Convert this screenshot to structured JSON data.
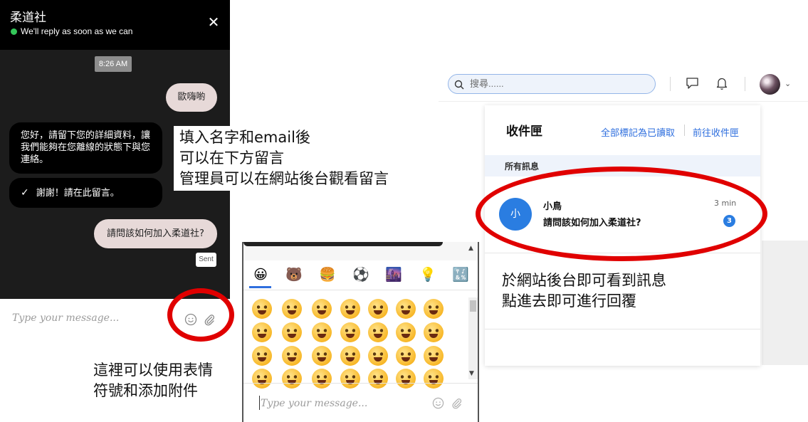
{
  "chat": {
    "title": "柔道社",
    "status": "We'll reply as soon as we can",
    "close_icon": "close-icon",
    "timestamp": "8:26 AM",
    "messages": {
      "hello": "歐嗨喲",
      "prompt": "您好，請留下您的詳細資料，讓我們能夠在您離線的狀態下與您連絡。",
      "thanks": "謝謝！請在此留言。",
      "question": "請問該如何加入柔道社?",
      "sent": "Sent"
    },
    "input_placeholder": "Type your message..."
  },
  "notes": {
    "fill_info": "填入名字和email後\n可以在下方留言\n管理員可以在網站後台觀看留言",
    "emoji_attach": "這裡可以使用表情\n符號和添加附件",
    "backend": "於網站後台即可看到訊息\n點進去即可進行回覆"
  },
  "picker": {
    "categories": [
      "😀",
      "🐻",
      "🍔",
      "⚽",
      "🌆",
      "💡",
      "🔣"
    ],
    "input_placeholder": "Type your message..."
  },
  "dashboard": {
    "search_placeholder": "搜尋......",
    "inbox_title": "收件匣",
    "mark_all_read": "全部標記為已讀取",
    "go_to_inbox": "前往收件匣",
    "section": "所有訊息",
    "message": {
      "avatar_letter": "小",
      "sender": "小鳥",
      "preview": "請問該如何加入柔道社?",
      "time": "3 min",
      "unread": "3"
    }
  },
  "colors": {
    "accent": "#2a7de1",
    "highlight_ring": "#e00000",
    "online": "#34c759"
  }
}
